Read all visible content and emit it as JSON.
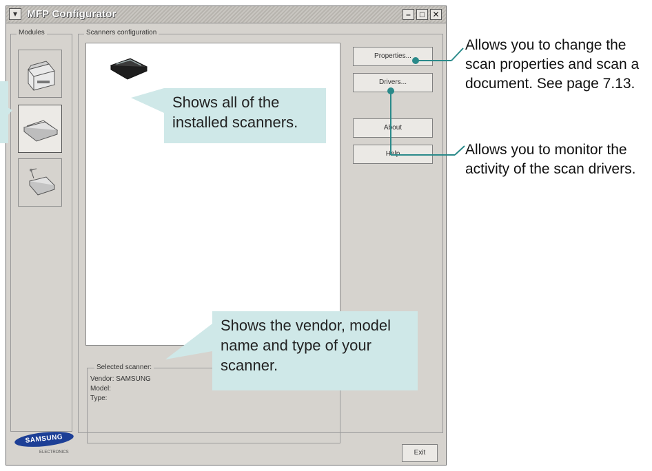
{
  "window": {
    "title": "MFP Configurator",
    "controls": {
      "minimize": "–",
      "maximize": "□",
      "close": "✕"
    }
  },
  "modules": {
    "label": "Modules",
    "items": [
      {
        "name": "printer",
        "icon": "printer-icon",
        "selected": false
      },
      {
        "name": "scanner",
        "icon": "scanner-icon",
        "selected": true
      },
      {
        "name": "port",
        "icon": "port-icon",
        "selected": false
      }
    ]
  },
  "scanners_config": {
    "label": "Scanners configuration",
    "scanner_icon": "scanner-icon"
  },
  "buttons": {
    "properties": "Properties...",
    "drivers": "Drivers...",
    "about": "About",
    "help": "Help",
    "exit": "Exit"
  },
  "selected_scanner": {
    "label": "Selected scanner:",
    "vendor": "Vendor: SAMSUNG",
    "model": "Model:",
    "type": "Type:"
  },
  "logo": {
    "text": "SAMSUNG",
    "sub": "ELECTRONICS"
  },
  "callouts": {
    "installed": "Shows all of the installed scanners.",
    "vendor": "Shows the vendor, model name and type of your scanner."
  },
  "notes": {
    "properties_note": "Allows you to change the scan properties and scan a document. See page 7.13.",
    "drivers_note": "Allows you to monitor the activity of the scan drivers."
  },
  "colors": {
    "callout_bg": "#cfe8e8",
    "callout_line": "#2a8a8a",
    "logo_blue": "#1d3f96"
  }
}
